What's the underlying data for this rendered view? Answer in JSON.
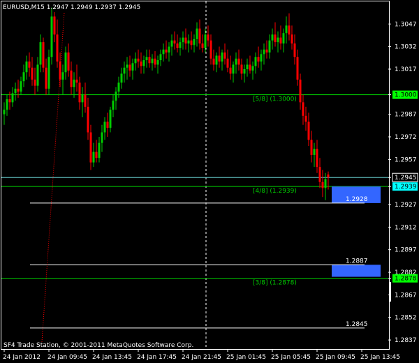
{
  "header": {
    "title": "EURUSD,M15  1.2947 1.2949 1.2937 1.2945"
  },
  "footer": {
    "copyright": "SF4 Trade Station, © 2001-2011 MetaQuotes Software Corp."
  },
  "colors": {
    "background": "#000000",
    "axis_text": "#ffffff",
    "bull_candle": "#00cc00",
    "bear_candle": "#ff0000",
    "murrey_line": "#00cc00",
    "murrey_label": "#00cc00",
    "bid_line": "#66cccc",
    "target_box": "#3366ff",
    "target_line": "#ffffff",
    "crosshair": "#ffffff",
    "price_tag_bid_bg": "#00ffff",
    "price_tag_level_bg": "#00ff00"
  },
  "chart_data": {
    "type": "candlestick",
    "symbol": "EURUSD",
    "timeframe": "M15",
    "ylim": [
      1.2831,
      1.3062
    ],
    "y_ticks": [
      "1.3047",
      "1.3032",
      "1.3017",
      "1.3000",
      "1.2987",
      "1.2972",
      "1.2957",
      "1.2945",
      "1.2939",
      "1.2927",
      "1.2912",
      "1.2897",
      "1.2882",
      "1.2878",
      "1.2867",
      "1.2852",
      "1.2837"
    ],
    "x_ticks": [
      {
        "label": "24 Jan 2012",
        "bar": 0
      },
      {
        "label": "24 Jan 09:45",
        "bar": 16
      },
      {
        "label": "24 Jan 13:45",
        "bar": 32
      },
      {
        "label": "24 Jan 17:45",
        "bar": 48
      },
      {
        "label": "24 Jan 21:45",
        "bar": 64
      },
      {
        "label": "25 Jan 01:45",
        "bar": 80
      },
      {
        "label": "25 Jan 05:45",
        "bar": 96
      },
      {
        "label": "25 Jan 09:45",
        "bar": 112
      },
      {
        "label": "25 Jan 13:45",
        "bar": 128
      }
    ],
    "ohlc": [
      [
        1.2987,
        1.2995,
        1.298,
        1.299
      ],
      [
        1.299,
        1.3,
        1.2986,
        1.2997
      ],
      [
        1.2997,
        1.3002,
        1.299,
        1.2995
      ],
      [
        1.2995,
        1.3005,
        1.2992,
        1.3001
      ],
      [
        1.3001,
        1.3008,
        1.2996,
        1.3004
      ],
      [
        1.3004,
        1.301,
        1.2998,
        1.3002
      ],
      [
        1.3002,
        1.3012,
        1.3,
        1.3009
      ],
      [
        1.3009,
        1.302,
        1.3005,
        1.3015
      ],
      [
        1.3015,
        1.3026,
        1.301,
        1.3022
      ],
      [
        1.3022,
        1.3028,
        1.3012,
        1.3018
      ],
      [
        1.3018,
        1.3025,
        1.3006,
        1.301
      ],
      [
        1.301,
        1.3018,
        1.3,
        1.3006
      ],
      [
        1.3006,
        1.3025,
        1.3002,
        1.302
      ],
      [
        1.302,
        1.304,
        1.3015,
        1.3035
      ],
      [
        1.3035,
        1.3038,
        1.3015,
        1.3018
      ],
      [
        1.3018,
        1.3024,
        1.3,
        1.3004
      ],
      [
        1.3004,
        1.303,
        1.3,
        1.3025
      ],
      [
        1.3025,
        1.3058,
        1.302,
        1.3052
      ],
      [
        1.3052,
        1.3055,
        1.3035,
        1.304
      ],
      [
        1.304,
        1.305,
        1.3018,
        1.3022
      ],
      [
        1.3022,
        1.3028,
        1.3005,
        1.301
      ],
      [
        1.301,
        1.302,
        1.3,
        1.3015
      ],
      [
        1.3015,
        1.3032,
        1.301,
        1.3028
      ],
      [
        1.3028,
        1.3034,
        1.3012,
        1.3016
      ],
      [
        1.3016,
        1.3022,
        1.3,
        1.3005
      ],
      [
        1.3005,
        1.3015,
        1.2998,
        1.301
      ],
      [
        1.301,
        1.302,
        1.3002,
        1.3008
      ],
      [
        1.3008,
        1.3012,
        1.299,
        1.2995
      ],
      [
        1.2995,
        1.3005,
        1.2985,
        1.3
      ],
      [
        1.3,
        1.3008,
        1.2988,
        1.2992
      ],
      [
        1.2992,
        1.2998,
        1.297,
        1.2975
      ],
      [
        1.2975,
        1.298,
        1.295,
        1.2955
      ],
      [
        1.2955,
        1.2968,
        1.2952,
        1.2962
      ],
      [
        1.2962,
        1.297,
        1.2955,
        1.2958
      ],
      [
        1.2958,
        1.2972,
        1.2955,
        1.2968
      ],
      [
        1.2968,
        1.298,
        1.2962,
        1.2975
      ],
      [
        1.2975,
        1.2985,
        1.297,
        1.2982
      ],
      [
        1.2982,
        1.2988,
        1.2972,
        1.2978
      ],
      [
        1.2978,
        1.2992,
        1.2975,
        1.299
      ],
      [
        1.299,
        1.3,
        1.2985,
        1.2996
      ],
      [
        1.2996,
        1.3005,
        1.299,
        1.3002
      ],
      [
        1.3002,
        1.3012,
        1.2998,
        1.3008
      ],
      [
        1.3008,
        1.3018,
        1.3004,
        1.3014
      ],
      [
        1.3014,
        1.3022,
        1.3008,
        1.3018
      ],
      [
        1.3018,
        1.3025,
        1.301,
        1.302
      ],
      [
        1.302,
        1.3026,
        1.3012,
        1.3016
      ],
      [
        1.3016,
        1.3024,
        1.301,
        1.3021
      ],
      [
        1.3021,
        1.3028,
        1.3016,
        1.3024
      ],
      [
        1.3024,
        1.303,
        1.3018,
        1.3022
      ],
      [
        1.3022,
        1.3028,
        1.3014,
        1.3019
      ],
      [
        1.3019,
        1.3026,
        1.3014,
        1.3023
      ],
      [
        1.3023,
        1.303,
        1.3018,
        1.3025
      ],
      [
        1.3025,
        1.303,
        1.3018,
        1.3021
      ],
      [
        1.3021,
        1.3027,
        1.3016,
        1.3024
      ],
      [
        1.3024,
        1.3029,
        1.3018,
        1.302
      ],
      [
        1.302,
        1.3026,
        1.3014,
        1.3023
      ],
      [
        1.3023,
        1.303,
        1.3019,
        1.3027
      ],
      [
        1.3027,
        1.3034,
        1.3022,
        1.303
      ],
      [
        1.303,
        1.3036,
        1.3024,
        1.3028
      ],
      [
        1.3028,
        1.3035,
        1.3022,
        1.3032
      ],
      [
        1.3032,
        1.304,
        1.3026,
        1.3036
      ],
      [
        1.3036,
        1.3042,
        1.303,
        1.3034
      ],
      [
        1.3034,
        1.304,
        1.3028,
        1.3031
      ],
      [
        1.3031,
        1.3038,
        1.3026,
        1.3035
      ],
      [
        1.3035,
        1.3042,
        1.303,
        1.3038
      ],
      [
        1.3038,
        1.3044,
        1.303,
        1.3034
      ],
      [
        1.3034,
        1.304,
        1.3028,
        1.3036
      ],
      [
        1.3036,
        1.3042,
        1.303,
        1.3033
      ],
      [
        1.3033,
        1.304,
        1.3028,
        1.3037
      ],
      [
        1.3037,
        1.3048,
        1.3032,
        1.3044
      ],
      [
        1.3044,
        1.305,
        1.303,
        1.3034
      ],
      [
        1.3034,
        1.304,
        1.3028,
        1.3031
      ],
      [
        1.3031,
        1.3044,
        1.3028,
        1.304
      ],
      [
        1.304,
        1.3046,
        1.3032,
        1.3036
      ],
      [
        1.3036,
        1.304,
        1.302,
        1.3024
      ],
      [
        1.3024,
        1.303,
        1.3016,
        1.302
      ],
      [
        1.302,
        1.3028,
        1.3015,
        1.3026
      ],
      [
        1.3026,
        1.3032,
        1.3018,
        1.3022
      ],
      [
        1.3022,
        1.303,
        1.3016,
        1.3028
      ],
      [
        1.3028,
        1.3034,
        1.302,
        1.3024
      ],
      [
        1.3024,
        1.303,
        1.3015,
        1.3018
      ],
      [
        1.3018,
        1.3026,
        1.301,
        1.3014
      ],
      [
        1.3014,
        1.3022,
        1.3008,
        1.302
      ],
      [
        1.302,
        1.3028,
        1.3014,
        1.3024
      ],
      [
        1.3024,
        1.303,
        1.3016,
        1.302
      ],
      [
        1.302,
        1.3024,
        1.301,
        1.3014
      ],
      [
        1.3014,
        1.302,
        1.3008,
        1.3017
      ],
      [
        1.3017,
        1.3024,
        1.3012,
        1.302
      ],
      [
        1.302,
        1.3026,
        1.3014,
        1.3016
      ],
      [
        1.3016,
        1.3022,
        1.301,
        1.3019
      ],
      [
        1.3019,
        1.3028,
        1.3014,
        1.3025
      ],
      [
        1.3025,
        1.3032,
        1.3018,
        1.3022
      ],
      [
        1.3022,
        1.303,
        1.3016,
        1.3027
      ],
      [
        1.3027,
        1.3034,
        1.302,
        1.303
      ],
      [
        1.303,
        1.3036,
        1.3024,
        1.3028
      ],
      [
        1.3028,
        1.304,
        1.3024,
        1.3036
      ],
      [
        1.3036,
        1.3044,
        1.303,
        1.304
      ],
      [
        1.304,
        1.3048,
        1.3032,
        1.3035
      ],
      [
        1.3035,
        1.3042,
        1.3028,
        1.3038
      ],
      [
        1.3038,
        1.3046,
        1.303,
        1.3034
      ],
      [
        1.3034,
        1.3044,
        1.3028,
        1.3041
      ],
      [
        1.3041,
        1.3052,
        1.3034,
        1.3046
      ],
      [
        1.3046,
        1.3054,
        1.3036,
        1.304
      ],
      [
        1.304,
        1.3046,
        1.303,
        1.3034
      ],
      [
        1.3034,
        1.304,
        1.302,
        1.3025
      ],
      [
        1.3025,
        1.303,
        1.3006,
        1.301
      ],
      [
        1.301,
        1.3014,
        1.299,
        1.2995
      ],
      [
        1.2995,
        1.3,
        1.298,
        1.2986
      ],
      [
        1.2986,
        1.2992,
        1.2976,
        1.2982
      ],
      [
        1.2982,
        1.2988,
        1.2966,
        1.297
      ],
      [
        1.297,
        1.2976,
        1.2955,
        1.296
      ],
      [
        1.296,
        1.2968,
        1.2952,
        1.2964
      ],
      [
        1.2964,
        1.297,
        1.2948,
        1.2952
      ],
      [
        1.2952,
        1.2958,
        1.2938,
        1.2942
      ],
      [
        1.2942,
        1.295,
        1.2932,
        1.2938
      ],
      [
        1.2938,
        1.2948,
        1.293,
        1.2944
      ],
      [
        1.2947,
        1.2949,
        1.2937,
        1.2945
      ]
    ],
    "annotations": {
      "murrey_levels": [
        {
          "price": 1.3,
          "label": "[5/8]  (1.3000)",
          "tag": "1.3000"
        },
        {
          "price": 1.2939,
          "label": "[4/8]  (1.2939)",
          "tag": "1.2939"
        },
        {
          "price": 1.2878,
          "label": "[3/8]  (1.2878)",
          "tag": "1.2878"
        }
      ],
      "current_bid": {
        "price": 1.2945,
        "tag": "1.2945"
      },
      "targets": [
        {
          "price": 1.2928,
          "label": "1.2928"
        },
        {
          "price": 1.2887,
          "label": "1.2887"
        },
        {
          "price": 1.2845,
          "label": "1.2845"
        }
      ],
      "zones": [
        {
          "from": 1.2939,
          "to": 1.2928
        },
        {
          "from": 1.2887,
          "to": 1.2879
        }
      ]
    }
  }
}
